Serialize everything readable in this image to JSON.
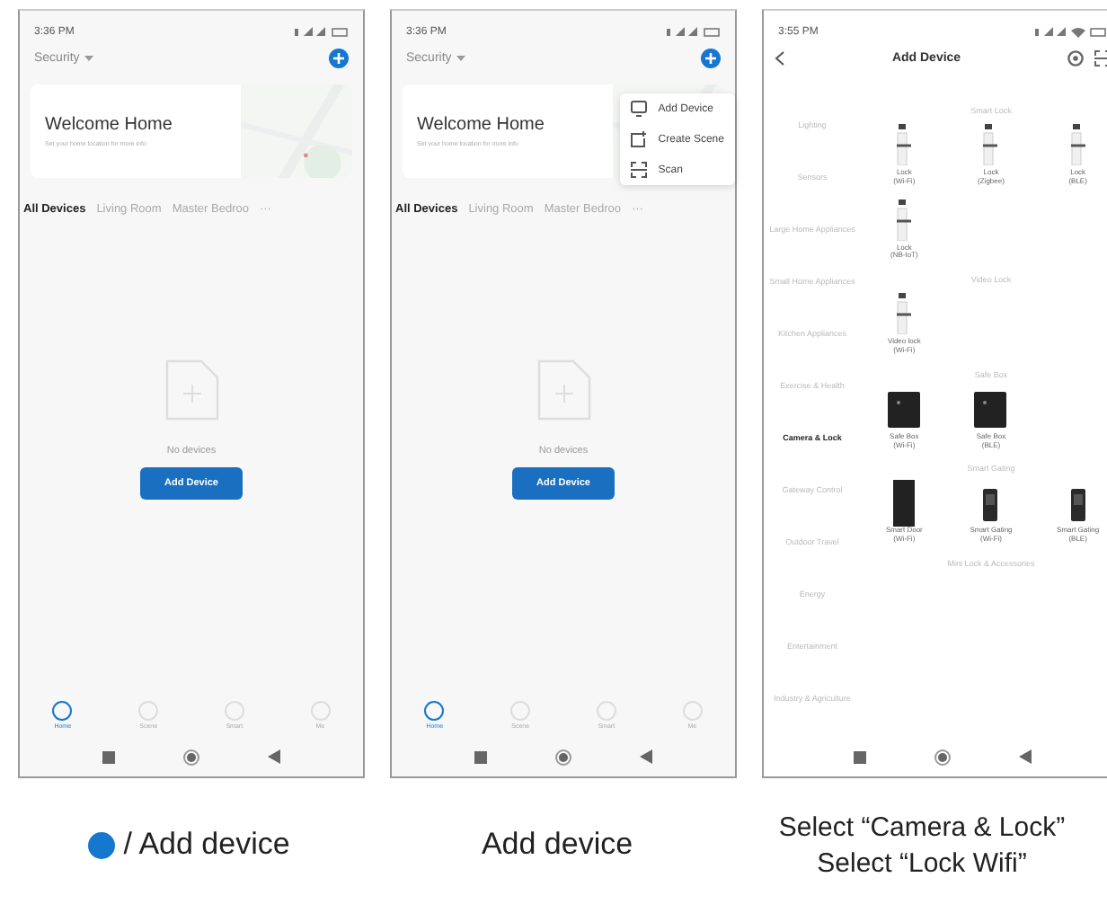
{
  "home_screens": [
    {
      "status_time": "3:36 PM",
      "home_selector": "Security",
      "banner": {
        "title": "Welcome Home",
        "subtitle": "Set your home location for more info"
      },
      "rooms": [
        {
          "label": "All Devices",
          "selected": true
        },
        {
          "label": "Living Room",
          "selected": false
        },
        {
          "label": "Master Bedroo",
          "selected": false
        }
      ],
      "more": "···",
      "empty_text": "No devices",
      "button": "Add Device",
      "bottom_tabs": [
        {
          "label": "Home",
          "selected": true
        },
        {
          "label": "Scene",
          "selected": false
        },
        {
          "label": "Smart",
          "selected": false
        },
        {
          "label": "Me",
          "selected": false
        }
      ]
    },
    {
      "status_time": "3:36 PM",
      "home_selector": "Security",
      "banner": {
        "title": "Welcome Home",
        "subtitle": "Set your home location for more info"
      },
      "rooms": [
        {
          "label": "All Devices",
          "selected": true
        },
        {
          "label": "Living Room",
          "selected": false
        },
        {
          "label": "Master Bedroo",
          "selected": false
        }
      ],
      "more": "···",
      "empty_text": "No devices",
      "button": "Add Device",
      "bottom_tabs": [
        {
          "label": "Home",
          "selected": true
        },
        {
          "label": "Scene",
          "selected": false
        },
        {
          "label": "Smart",
          "selected": false
        },
        {
          "label": "Me",
          "selected": false
        }
      ],
      "menu": [
        {
          "label": "Add Device",
          "kind": "device"
        },
        {
          "label": "Create Scene",
          "kind": "scene"
        },
        {
          "label": "Scan",
          "kind": "scan"
        }
      ]
    }
  ],
  "add_device_screen": {
    "status_time": "3:55 PM",
    "title": "Add Device",
    "categories": [
      {
        "label": "Lighting",
        "selected": false
      },
      {
        "label": "Sensors",
        "selected": false
      },
      {
        "label": "Large Home Appliances",
        "selected": false
      },
      {
        "label": "Small Home Appliances",
        "selected": false
      },
      {
        "label": "Kitchen Appliances",
        "selected": false
      },
      {
        "label": "Exercise & Health",
        "selected": false
      },
      {
        "label": "Camera & Lock",
        "selected": true
      },
      {
        "label": "Gateway Control",
        "selected": false
      },
      {
        "label": "Outdoor Travel",
        "selected": false
      },
      {
        "label": "Energy",
        "selected": false
      },
      {
        "label": "Entertainment",
        "selected": false
      },
      {
        "label": "Industry & Agriculture",
        "selected": false
      }
    ],
    "sections": [
      {
        "title": "Smart Lock",
        "items": [
          {
            "name": "Lock",
            "variant": "(Wi-Fi)",
            "kind": "lock"
          },
          {
            "name": "Lock",
            "variant": "(Zigbee)",
            "kind": "lock"
          },
          {
            "name": "Lock",
            "variant": "(BLE)",
            "kind": "lock"
          },
          {
            "name": "Lock",
            "variant": "(NB-IoT)",
            "kind": "lock"
          }
        ]
      },
      {
        "title": "Video Lock",
        "items": [
          {
            "name": "Video lock",
            "variant": "(Wi-Fi)",
            "kind": "lock"
          }
        ]
      },
      {
        "title": "Safe Box",
        "items": [
          {
            "name": "Safe Box",
            "variant": "(Wi-Fi)",
            "kind": "safe"
          },
          {
            "name": "Safe Box",
            "variant": "(BLE)",
            "kind": "safe"
          }
        ]
      },
      {
        "title": "Smart Gating",
        "items": [
          {
            "name": "Smart Door",
            "variant": "(Wi-Fi)",
            "kind": "door"
          },
          {
            "name": "Smart Gating",
            "variant": "(Wi-Fi)",
            "kind": "gate"
          },
          {
            "name": "Smart Gating",
            "variant": "(BLE)",
            "kind": "gate"
          }
        ]
      },
      {
        "title": "Mini Lock & Accessories"
      }
    ]
  },
  "captions": [
    {
      "text": "/ Add device",
      "dot": true
    },
    {
      "text": "Add device",
      "dot": false
    },
    {
      "text": "Select “Camera & Lock”\nSelect “Lock Wifi”",
      "dot": false
    }
  ]
}
